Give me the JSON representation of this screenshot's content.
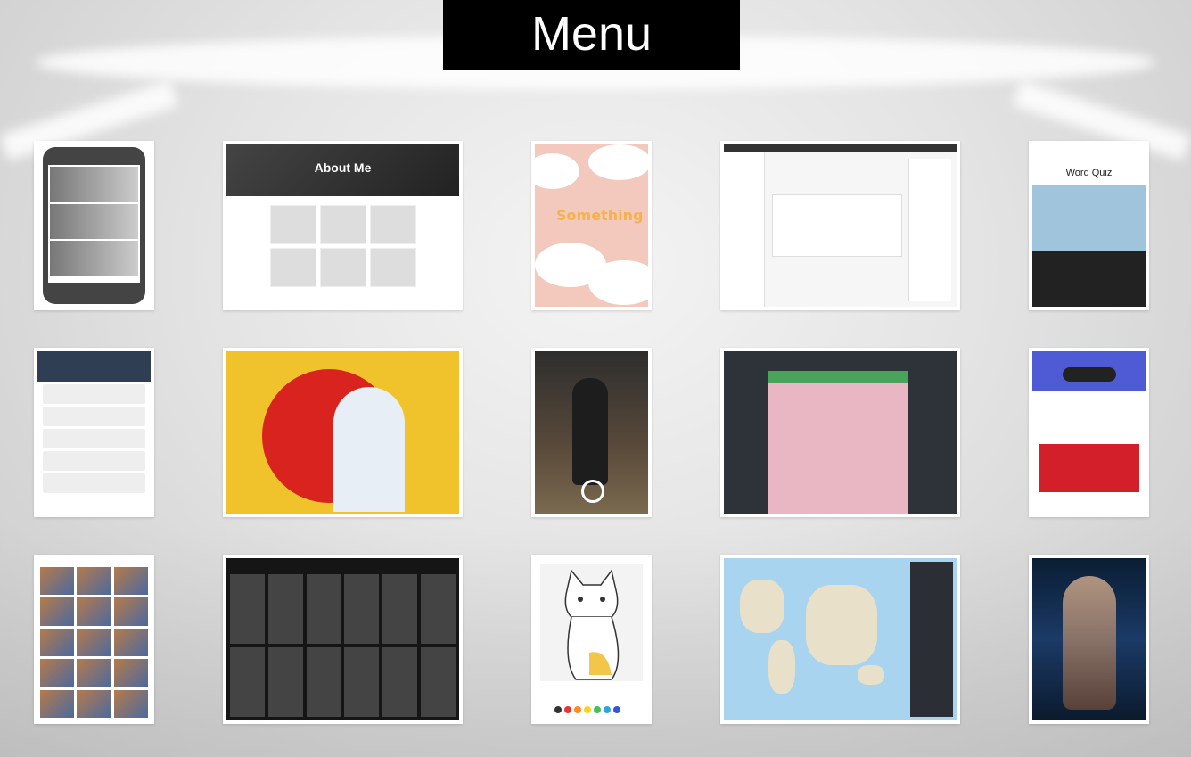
{
  "header": {
    "title": "Menu"
  },
  "cards": [
    {
      "id": "phone-app"
    },
    {
      "id": "about-me",
      "hero": "About Me"
    },
    {
      "id": "something",
      "label": "Something"
    },
    {
      "id": "dashboard"
    },
    {
      "id": "word-quiz",
      "title": "Word Quiz"
    },
    {
      "id": "line"
    },
    {
      "id": "food-ad"
    },
    {
      "id": "game-3d"
    },
    {
      "id": "keyword"
    },
    {
      "id": "car-sale"
    },
    {
      "id": "video-grid"
    },
    {
      "id": "card-grid"
    },
    {
      "id": "drawing"
    },
    {
      "id": "world-map"
    },
    {
      "id": "reality-queen"
    }
  ]
}
